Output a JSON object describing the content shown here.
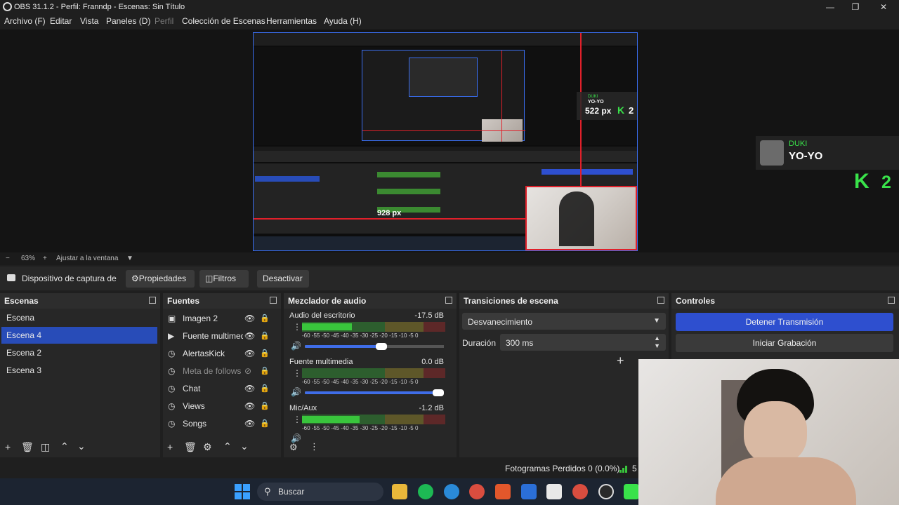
{
  "window": {
    "title": "OBS 31.1.2 - Perfil: Franndp - Escenas: Sin Título"
  },
  "menu": [
    "Archivo (F)",
    "Editar",
    "Vista",
    "Paneles (D)",
    "Perfil",
    "Colección de Escenas",
    "Herramientas",
    "Ayuda (H)"
  ],
  "menu_disabled": "Perfil",
  "preview": {
    "overlay_artist": "DUKI",
    "overlay_song": "YO-YO",
    "overlay_count": "2",
    "inner_width_label": "522 px",
    "inner_height_label": "928 px",
    "inner_count": "2"
  },
  "zoom": {
    "minus": "−",
    "value": "63%",
    "plus": "+",
    "fit": "Ajustar a la ventana"
  },
  "source_toolbar": {
    "selected_source": "Dispositivo de captura de v",
    "properties": "Propiedades",
    "filters": "Filtros",
    "deactivate": "Desactivar"
  },
  "scenes": {
    "title": "Escenas",
    "items": [
      "Escena",
      "Escena 4",
      "Escena 2",
      "Escena 3"
    ],
    "selected": "Escena 4"
  },
  "sources": {
    "title": "Fuentes",
    "items": [
      {
        "label": "Imagen 2",
        "icon": "image-icon"
      },
      {
        "label": "Fuente multimedia",
        "icon": "play-icon"
      },
      {
        "label": "AlertasKick",
        "icon": "browser-icon"
      },
      {
        "label": "Meta de follows",
        "icon": "browser-icon"
      },
      {
        "label": "Chat",
        "icon": "browser-icon"
      },
      {
        "label": "Views",
        "icon": "browser-icon"
      },
      {
        "label": "Songs",
        "icon": "browser-icon"
      }
    ]
  },
  "mixer": {
    "title": "Mezclador de audio",
    "channels": [
      {
        "name": "Audio del escritorio",
        "db": "-17.5 dB",
        "level": 0.35,
        "volume": 0.52
      },
      {
        "name": "Fuente multimedia",
        "db": "0.0 dB",
        "level": 0.0,
        "volume": 1.0
      },
      {
        "name": "Mic/Aux",
        "db": "-1.2 dB",
        "level": 0.4,
        "volume": 0.9
      }
    ],
    "ticks": "-60 -55 -50 -45 -40 -35 -30 -25 -20 -15 -10 -5 0"
  },
  "transitions": {
    "title": "Transiciones de escena",
    "selected": "Desvanecimiento",
    "duration_label": "Duración",
    "duration_value": "300 ms"
  },
  "controls": {
    "title": "Controles",
    "stop_stream": "Detener Transmisión",
    "start_recording": "Iniciar Grabación"
  },
  "status": {
    "dropped_frames": "Fotogramas Perdidos 0 (0.0%)",
    "extra": "5"
  },
  "taskbar": {
    "search": "Buscar"
  },
  "colors": {
    "accent": "#284cb8",
    "stream_button": "#2e4fcf",
    "meter_green": "#39c53c",
    "meter_yellow": "#c7b22f",
    "meter_red": "#c42a2a",
    "kick": "#39e24a"
  }
}
